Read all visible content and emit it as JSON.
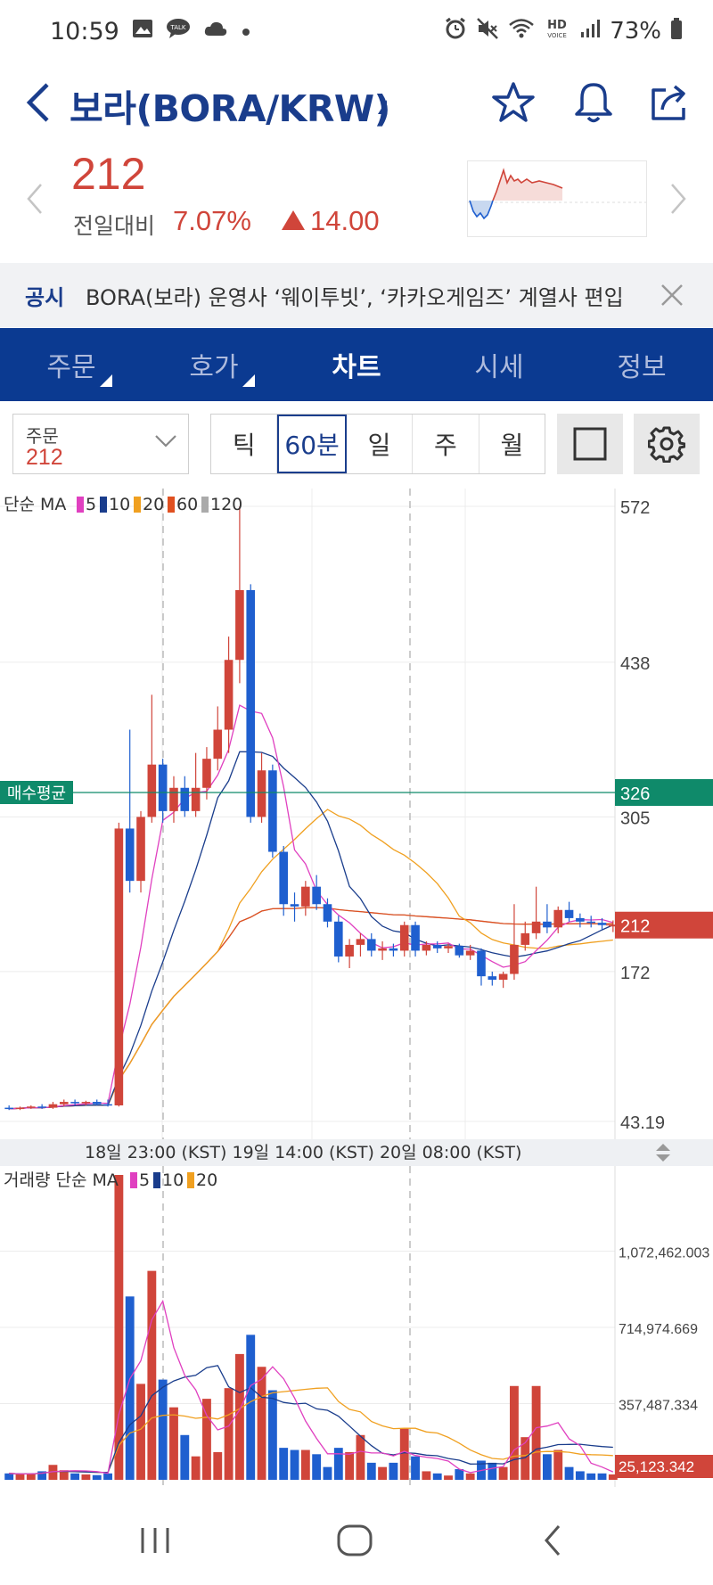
{
  "status_bar": {
    "time": "10:59",
    "battery": "73%",
    "icons": [
      "image-icon",
      "talk-icon",
      "cloud-icon",
      "dot-icon",
      "alarm-icon",
      "mute-icon",
      "wifi-icon",
      "hd-voice-icon",
      "signal-icon",
      "battery-icon"
    ]
  },
  "header": {
    "title": "보라(BORA/KRW)"
  },
  "price": {
    "current": "212",
    "change_label": "전일대비",
    "change_percent": "7.07%",
    "change_abs": "14.00",
    "color_up": "#d0453a"
  },
  "notice": {
    "tag": "공시",
    "text": "BORA(보라) 운영사 ‘웨이투빗’, ‘카카오게임즈’ 계열사 편입"
  },
  "tabs": [
    {
      "label": "주문",
      "active": false
    },
    {
      "label": "호가",
      "active": false
    },
    {
      "label": "차트",
      "active": true
    },
    {
      "label": "시세",
      "active": false
    },
    {
      "label": "정보",
      "active": false
    }
  ],
  "toolbar": {
    "order_label": "주문",
    "order_value": "212",
    "periods": [
      "틱",
      "60분",
      "일",
      "주",
      "월"
    ],
    "active_period": "60분"
  },
  "colors": {
    "brand": "#0b3a91",
    "up": "#d0453a",
    "down": "#1f5fcf",
    "ma5": "#e040c0",
    "ma10": "#1a3d8c",
    "ma20": "#f0a020",
    "ma60": "#e05020",
    "ma120": "#aaaaaa",
    "avg_line": "#0f8a6a"
  },
  "chart_data": [
    {
      "type": "candlestick",
      "title": "",
      "ma_label": "단순 MA",
      "ma_periods": [
        "5",
        "10",
        "20",
        "60",
        "120"
      ],
      "y_ticks": [
        "572",
        "438",
        "305",
        "172",
        "43.19"
      ],
      "ylim": [
        43.19,
        572
      ],
      "avg_buy_label": "매수평균",
      "avg_buy_value": "326",
      "current_value": "212",
      "x_labels": [
        "18일 23:00 (KST)",
        "19일 14:00 (KST)",
        "20일 08:00 (KST)"
      ],
      "candles": [
        {
          "o": 55,
          "h": 57,
          "l": 53,
          "c": 54
        },
        {
          "o": 54,
          "h": 56,
          "l": 53,
          "c": 55
        },
        {
          "o": 55,
          "h": 57,
          "l": 54,
          "c": 56
        },
        {
          "o": 56,
          "h": 58,
          "l": 54,
          "c": 55
        },
        {
          "o": 55,
          "h": 60,
          "l": 54,
          "c": 58
        },
        {
          "o": 58,
          "h": 62,
          "l": 56,
          "c": 60
        },
        {
          "o": 60,
          "h": 62,
          "l": 57,
          "c": 59
        },
        {
          "o": 59,
          "h": 61,
          "l": 57,
          "c": 60
        },
        {
          "o": 60,
          "h": 62,
          "l": 57,
          "c": 58
        },
        {
          "o": 58,
          "h": 62,
          "l": 56,
          "c": 57
        },
        {
          "o": 57,
          "h": 300,
          "l": 56,
          "c": 295
        },
        {
          "o": 295,
          "h": 380,
          "l": 240,
          "c": 250
        },
        {
          "o": 250,
          "h": 310,
          "l": 240,
          "c": 305
        },
        {
          "o": 305,
          "h": 410,
          "l": 300,
          "c": 350
        },
        {
          "o": 350,
          "h": 355,
          "l": 300,
          "c": 310
        },
        {
          "o": 310,
          "h": 340,
          "l": 300,
          "c": 330
        },
        {
          "o": 330,
          "h": 340,
          "l": 305,
          "c": 310
        },
        {
          "o": 310,
          "h": 360,
          "l": 305,
          "c": 330
        },
        {
          "o": 330,
          "h": 365,
          "l": 320,
          "c": 355
        },
        {
          "o": 355,
          "h": 400,
          "l": 345,
          "c": 380
        },
        {
          "o": 380,
          "h": 460,
          "l": 360,
          "c": 440
        },
        {
          "o": 440,
          "h": 572,
          "l": 420,
          "c": 500
        },
        {
          "o": 500,
          "h": 505,
          "l": 300,
          "c": 305
        },
        {
          "o": 305,
          "h": 360,
          "l": 300,
          "c": 345
        },
        {
          "o": 345,
          "h": 350,
          "l": 270,
          "c": 275
        },
        {
          "o": 275,
          "h": 280,
          "l": 220,
          "c": 230
        },
        {
          "o": 230,
          "h": 240,
          "l": 215,
          "c": 228
        },
        {
          "o": 228,
          "h": 250,
          "l": 220,
          "c": 245
        },
        {
          "o": 245,
          "h": 255,
          "l": 225,
          "c": 230
        },
        {
          "o": 230,
          "h": 235,
          "l": 210,
          "c": 215
        },
        {
          "o": 215,
          "h": 220,
          "l": 180,
          "c": 185
        },
        {
          "o": 185,
          "h": 200,
          "l": 175,
          "c": 195
        },
        {
          "o": 195,
          "h": 205,
          "l": 185,
          "c": 200
        },
        {
          "o": 200,
          "h": 205,
          "l": 185,
          "c": 190
        },
        {
          "o": 190,
          "h": 198,
          "l": 182,
          "c": 192
        },
        {
          "o": 192,
          "h": 196,
          "l": 185,
          "c": 190
        },
        {
          "o": 190,
          "h": 215,
          "l": 185,
          "c": 212
        },
        {
          "o": 212,
          "h": 215,
          "l": 185,
          "c": 190
        },
        {
          "o": 190,
          "h": 198,
          "l": 186,
          "c": 195
        },
        {
          "o": 195,
          "h": 198,
          "l": 188,
          "c": 192
        },
        {
          "o": 192,
          "h": 196,
          "l": 188,
          "c": 194
        },
        {
          "o": 194,
          "h": 196,
          "l": 184,
          "c": 186
        },
        {
          "o": 186,
          "h": 195,
          "l": 182,
          "c": 190
        },
        {
          "o": 190,
          "h": 192,
          "l": 160,
          "c": 168
        },
        {
          "o": 168,
          "h": 172,
          "l": 160,
          "c": 165
        },
        {
          "o": 165,
          "h": 172,
          "l": 158,
          "c": 170
        },
        {
          "o": 170,
          "h": 230,
          "l": 165,
          "c": 195
        },
        {
          "o": 195,
          "h": 215,
          "l": 190,
          "c": 205
        },
        {
          "o": 205,
          "h": 245,
          "l": 200,
          "c": 215
        },
        {
          "o": 215,
          "h": 230,
          "l": 205,
          "c": 210
        },
        {
          "o": 210,
          "h": 228,
          "l": 205,
          "c": 225
        },
        {
          "o": 225,
          "h": 232,
          "l": 215,
          "c": 218
        },
        {
          "o": 218,
          "h": 222,
          "l": 210,
          "c": 215
        },
        {
          "o": 215,
          "h": 220,
          "l": 210,
          "c": 214
        },
        {
          "o": 214,
          "h": 218,
          "l": 208,
          "c": 212
        },
        {
          "o": 212,
          "h": 216,
          "l": 206,
          "c": 212
        }
      ]
    },
    {
      "type": "bar",
      "title": "",
      "ma_label": "거래량 단순 MA",
      "ma_periods": [
        "5",
        "10",
        "20"
      ],
      "y_ticks": [
        "1,072,462.003",
        "714,974.669",
        "357,487.334"
      ],
      "current_value": "25,123.342",
      "ylim": [
        0,
        1430000
      ],
      "values": [
        30000,
        25000,
        28000,
        40000,
        70000,
        45000,
        30000,
        25000,
        22000,
        30000,
        1430000,
        860000,
        450000,
        980000,
        470000,
        340000,
        210000,
        110000,
        380000,
        130000,
        430000,
        590000,
        680000,
        530000,
        420000,
        150000,
        140000,
        140000,
        120000,
        60000,
        150000,
        130000,
        210000,
        80000,
        60000,
        80000,
        240000,
        110000,
        40000,
        30000,
        20000,
        50000,
        30000,
        90000,
        80000,
        60000,
        440000,
        200000,
        440000,
        120000,
        140000,
        60000,
        40000,
        30000,
        30000,
        25123
      ]
    }
  ],
  "nav": {
    "buttons": [
      "recent-apps",
      "home",
      "back"
    ]
  }
}
